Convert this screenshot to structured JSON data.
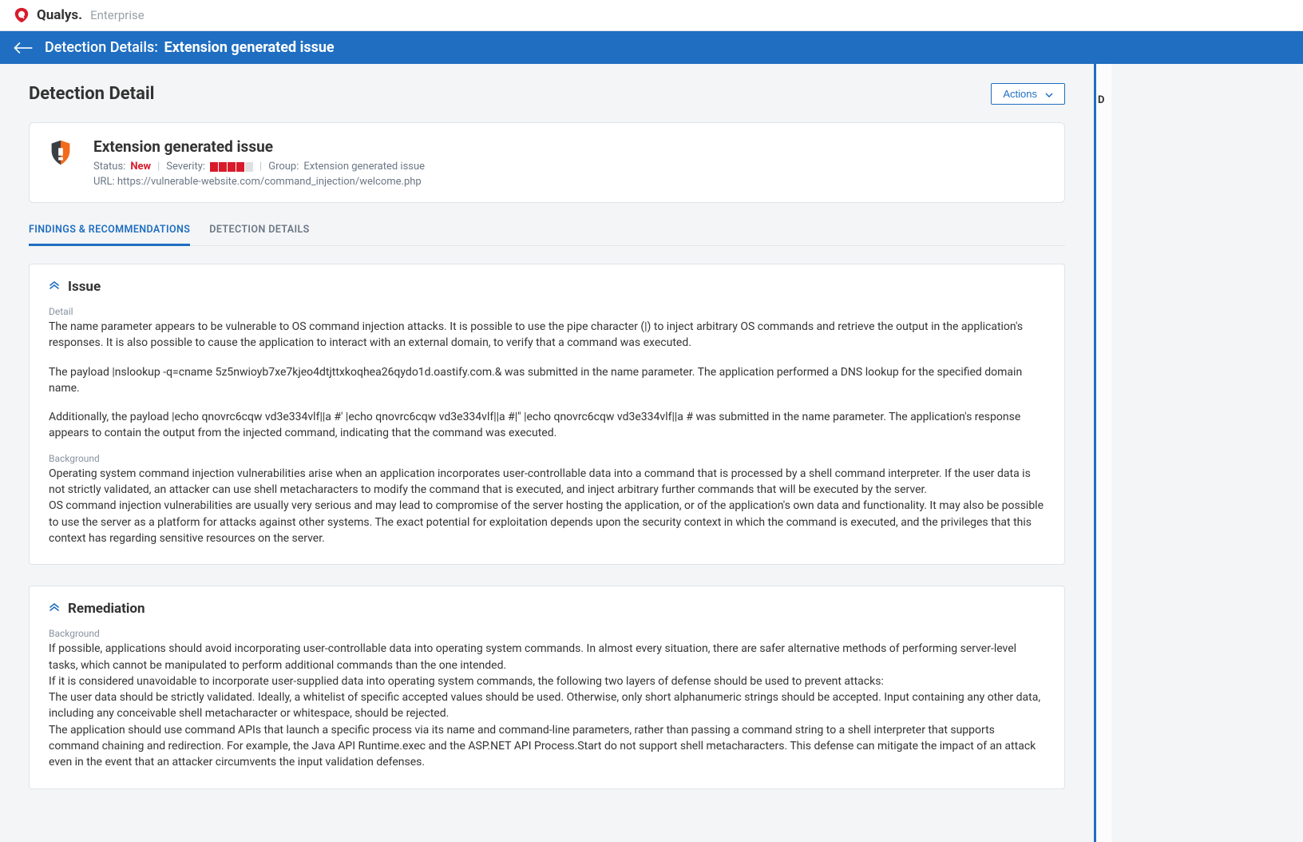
{
  "brand": {
    "name": "Qualys.",
    "sub": "Enterprise"
  },
  "bluebar": {
    "label": "Detection Details:",
    "title": "Extension generated issue"
  },
  "page": {
    "title": "Detection Detail",
    "actions_label": "Actions"
  },
  "summary": {
    "title": "Extension generated issue",
    "status_label": "Status:",
    "status_value": "New",
    "severity_label": "Severity:",
    "severity_filled": 4,
    "severity_total": 5,
    "group_label": "Group:",
    "group_value": "Extension generated issue",
    "url_label": "URL:",
    "url_value": "https://vulnerable-website.com/command_injection/welcome.php"
  },
  "tabs": {
    "findings": "FINDINGS & RECOMMENDATIONS",
    "details": "DETECTION DETAILS",
    "active": "findings"
  },
  "issue": {
    "heading": "Issue",
    "detail_label": "Detail",
    "detail_text_1": "The name parameter appears to be vulnerable to OS command injection attacks. It is possible to use the pipe character (|) to inject arbitrary OS commands and retrieve the output in the application's responses. It is also possible to cause the application to interact with an external domain, to verify that a command was executed.",
    "detail_text_2": "The payload |nslookup -q=cname 5z5nwioyb7xe7kjeo4dtjttxkoqhea26qydo1d.oastify.com.& was submitted in the name parameter. The application performed a DNS lookup for the specified domain name.",
    "detail_text_3": "Additionally, the payload |echo qnovrc6cqw vd3e334vlf||a #' |echo qnovrc6cqw vd3e334vlf||a #|\" |echo qnovrc6cqw vd3e334vlf||a # was submitted in the name parameter. The application's response appears to contain the output from the injected command, indicating that the command was executed.",
    "background_label": "Background",
    "background_text_1": "Operating system command injection vulnerabilities arise when an application incorporates user-controllable data into a command that is processed by a shell command interpreter. If the user data is not strictly validated, an attacker can use shell metacharacters to modify the command that is executed, and inject arbitrary further commands that will be executed by the server.",
    "background_text_2": "OS command injection vulnerabilities are usually very serious and may lead to compromise of the server hosting the application, or of the application's own data and functionality. It may also be possible to use the server as a platform for attacks against other systems. The exact potential for exploitation depends upon the security context in which the command is executed, and the privileges that this context has regarding sensitive resources on the server."
  },
  "remediation": {
    "heading": "Remediation",
    "background_label": "Background",
    "text_1": "If possible, applications should avoid incorporating user-controllable data into operating system commands. In almost every situation, there are safer alternative methods of performing server-level tasks, which cannot be manipulated to perform additional commands than the one intended.",
    "text_2": "If it is considered unavoidable to incorporate user-supplied data into operating system commands, the following two layers of defense should be used to prevent attacks:",
    "text_3": "The user data should be strictly validated. Ideally, a whitelist of specific accepted values should be used. Otherwise, only short alphanumeric strings should be accepted. Input containing any other data, including any conceivable shell metacharacter or whitespace, should be rejected.",
    "text_4": "The application should use command APIs that launch a specific process via its name and command-line parameters, rather than passing a command string to a shell interpreter that supports command chaining and redirection. For example, the Java API Runtime.exec and the ASP.NET API Process.Start do not support shell metacharacters. This defense can mitigate the impact of an attack even in the event that an attacker circumvents the input validation defenses."
  },
  "rail": {
    "item_d": "D"
  }
}
